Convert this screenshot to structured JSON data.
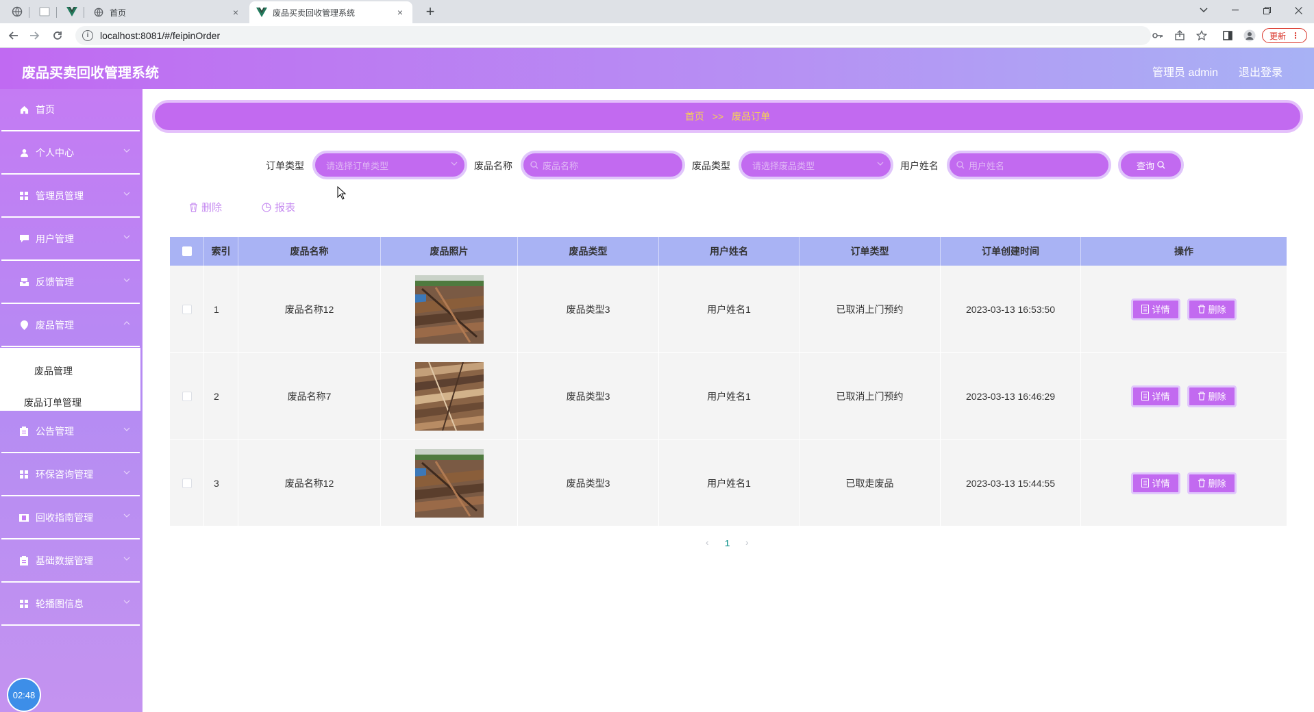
{
  "browser": {
    "tabs": [
      {
        "title": "首页",
        "close": "×"
      },
      {
        "title": "废品买卖回收管理系统",
        "close": "×"
      }
    ],
    "new_tab": "+",
    "url": "localhost:8081/#/feipinOrder",
    "update_label": "更新"
  },
  "header": {
    "title": "废品买卖回收管理系统",
    "admin": "管理员 admin",
    "logout": "退出登录"
  },
  "sidebar": {
    "items": [
      {
        "label": "首页",
        "icon": "home-icon"
      },
      {
        "label": "个人中心",
        "icon": "user-icon"
      },
      {
        "label": "管理员管理",
        "icon": "grid-icon"
      },
      {
        "label": "用户管理",
        "icon": "chat-icon"
      },
      {
        "label": "反馈管理",
        "icon": "inbox-icon"
      },
      {
        "label": "废品管理",
        "icon": "location-icon"
      },
      {
        "label": "公告管理",
        "icon": "clipboard-icon"
      },
      {
        "label": "环保咨询管理",
        "icon": "grid-icon"
      },
      {
        "label": "回收指南管理",
        "icon": "film-icon"
      },
      {
        "label": "基础数据管理",
        "icon": "clipboard-icon"
      },
      {
        "label": "轮播图信息",
        "icon": "grid-icon"
      }
    ],
    "submenu": [
      "废品管理",
      "废品订单管理"
    ],
    "clock": "02:48"
  },
  "breadcrumb": {
    "home": "首页",
    "separator": ">>",
    "current": "废品订单"
  },
  "filters": {
    "order_type_label": "订单类型",
    "order_type_placeholder": "请选择订单类型",
    "name_label": "废品名称",
    "name_placeholder": "废品名称",
    "type_label": "废品类型",
    "type_placeholder": "请选择废品类型",
    "user_label": "用户姓名",
    "user_placeholder": "用户姓名",
    "query_label": "查询"
  },
  "actions": {
    "delete": "删除",
    "report": "报表"
  },
  "table": {
    "columns": [
      "索引",
      "废品名称",
      "废品照片",
      "废品类型",
      "用户姓名",
      "订单类型",
      "订单创建时间",
      "操作"
    ],
    "rows": [
      {
        "index": "1",
        "name": "废品名称12",
        "type": "废品类型3",
        "user": "用户姓名1",
        "order_type": "已取消上门预约",
        "created": "2023-03-13 16:53:50"
      },
      {
        "index": "2",
        "name": "废品名称7",
        "type": "废品类型3",
        "user": "用户姓名1",
        "order_type": "已取消上门预约",
        "created": "2023-03-13 16:46:29"
      },
      {
        "index": "3",
        "name": "废品名称12",
        "type": "废品类型3",
        "user": "用户姓名1",
        "order_type": "已取走废品",
        "created": "2023-03-13 15:44:55"
      }
    ],
    "detail_label": "详情",
    "delete_label": "删除"
  },
  "pagination": {
    "current_page": "1",
    "prev": "‹",
    "next": "›"
  },
  "colors": {
    "primary": "#c26af0",
    "header_bg": "#a9b3f4",
    "breadcrumb_text": "#f6d451"
  }
}
